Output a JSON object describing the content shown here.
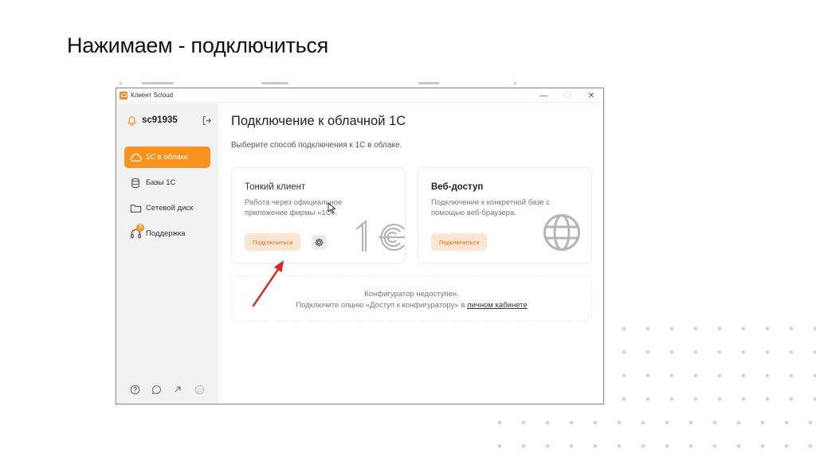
{
  "slide": {
    "title": "Нажимаем - подключиться"
  },
  "window": {
    "title": "Клиент Scloud",
    "controls": {
      "minimize": "—",
      "maximize": "☐",
      "close": "✕"
    }
  },
  "sidebar": {
    "username": "sc91935",
    "nav": [
      {
        "label": "1С в облаке",
        "icon": "cloud-icon",
        "active": true
      },
      {
        "label": "Базы 1С",
        "icon": "database-icon",
        "active": false
      },
      {
        "label": "Сетевой диск",
        "icon": "folder-icon",
        "active": false
      },
      {
        "label": "Поддержка",
        "icon": "headset-icon",
        "active": false,
        "badge": "3"
      }
    ],
    "footer_icons": [
      "help-icon",
      "chat-icon",
      "external-link-icon",
      "smile-icon"
    ]
  },
  "main": {
    "title": "Подключение к облачной 1С",
    "subtitle": "Выберите способ подключения к 1С в облаке.",
    "thin_client": {
      "title": "Тонкий клиент",
      "desc": "Работа через официальное приложение фирмы «1С».",
      "button": "Подключиться"
    },
    "web_access": {
      "title": "Веб-доступ",
      "desc": "Подключение к конкретной базе с помощью веб-браузера.",
      "button": "Подключиться"
    },
    "configurator": {
      "line1": "Конфигуратор недоступен.",
      "line2_prefix": "Подключите опцию «Доступ к конфигуратору» в ",
      "line2_link": "личном кабинете"
    }
  },
  "colors": {
    "accent": "#f7931e",
    "button_bg": "#fde6d1",
    "button_text": "#e0701a",
    "arrow": "#e0211c"
  }
}
